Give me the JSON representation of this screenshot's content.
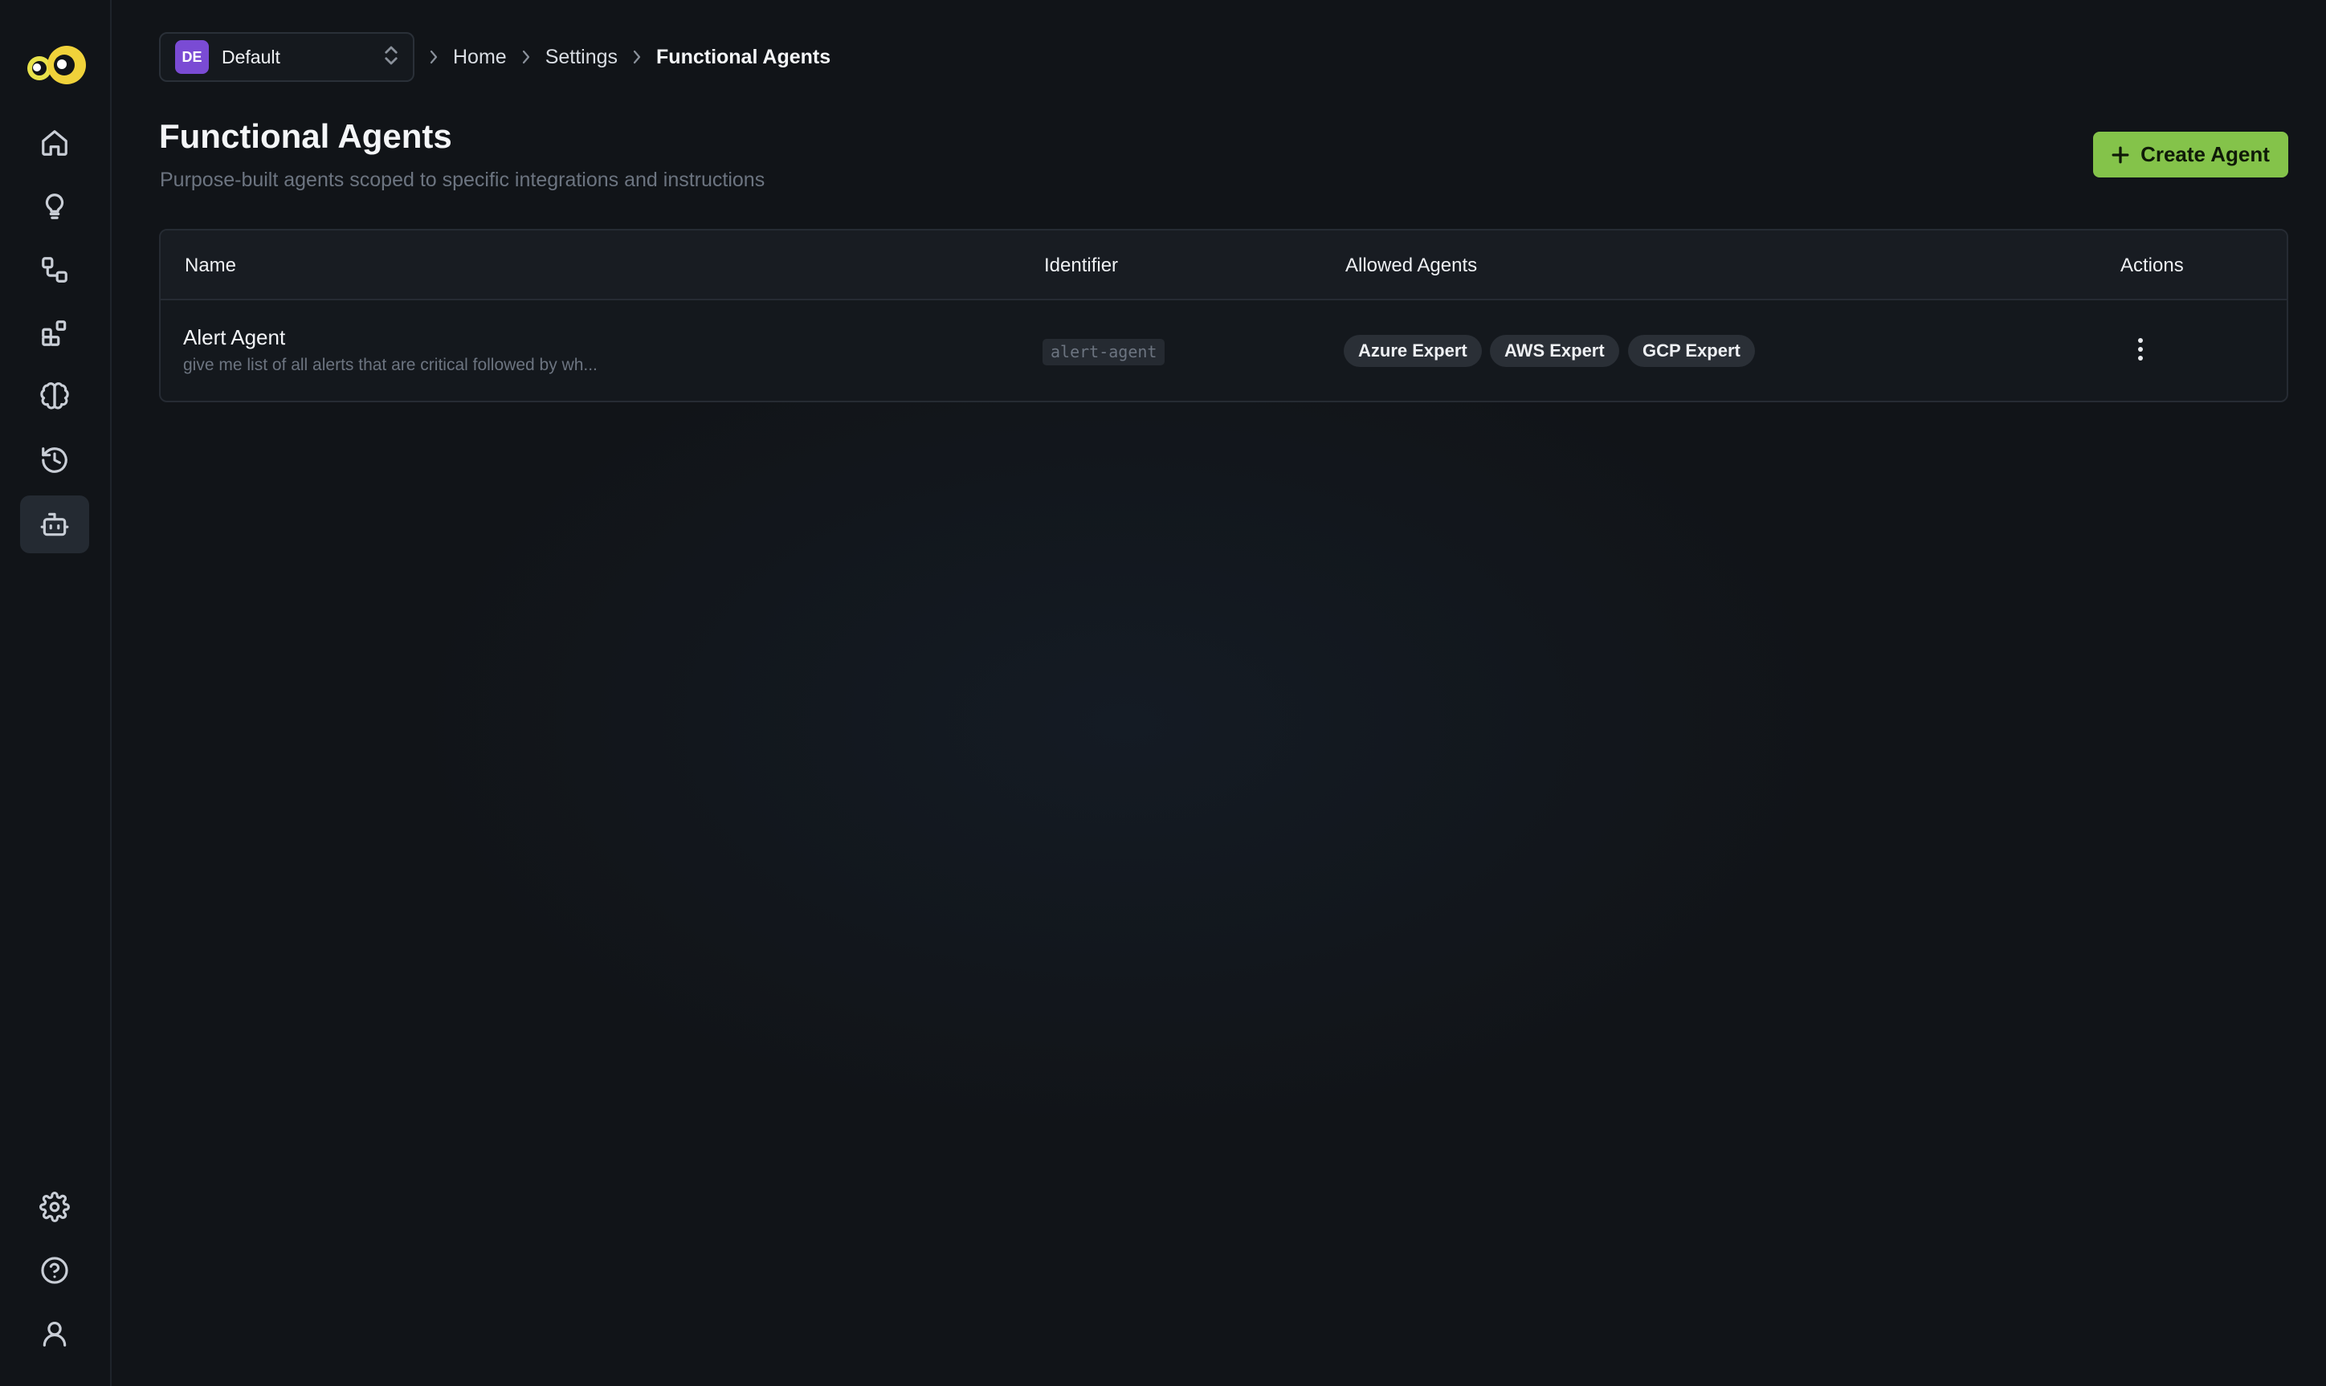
{
  "sidebar": {
    "nav": [
      {
        "icon": "home-icon",
        "label": "Home"
      },
      {
        "icon": "lightbulb-icon",
        "label": "Ideas"
      },
      {
        "icon": "workflow-icon",
        "label": "Workflows"
      },
      {
        "icon": "integrations-icon",
        "label": "Integrations"
      },
      {
        "icon": "brain-icon",
        "label": "Knowledge"
      },
      {
        "icon": "history-icon",
        "label": "History"
      },
      {
        "icon": "bot-icon",
        "label": "Functional Agents",
        "active": true
      }
    ],
    "bottom": [
      {
        "icon": "gear-icon",
        "label": "Settings"
      },
      {
        "icon": "help-icon",
        "label": "Help"
      },
      {
        "icon": "user-icon",
        "label": "Profile"
      }
    ]
  },
  "workspace": {
    "initials": "DE",
    "name": "Default"
  },
  "breadcrumb": {
    "home": "Home",
    "settings": "Settings",
    "current": "Functional Agents"
  },
  "page": {
    "title": "Functional Agents",
    "subtitle": "Purpose-built agents scoped to specific integrations and instructions",
    "create_label": "Create Agent"
  },
  "table": {
    "headers": {
      "name": "Name",
      "identifier": "Identifier",
      "allowed": "Allowed Agents",
      "actions": "Actions"
    },
    "rows": [
      {
        "name": "Alert Agent",
        "description": "give me list of all alerts that are critical followed by wh...",
        "identifier": "alert-agent",
        "allowed": [
          "Azure Expert",
          "AWS Expert",
          "GCP Expert"
        ]
      }
    ]
  },
  "colors": {
    "background": "#111418",
    "accent": "#84c34a",
    "workspace_avatar": "#7a4bd4"
  }
}
